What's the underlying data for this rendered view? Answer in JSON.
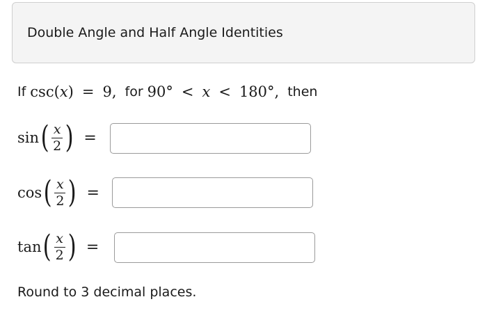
{
  "header": {
    "title": "Double Angle and Half Angle Identities"
  },
  "question": {
    "if_label": "If",
    "csc_fn": "csc",
    "open_paren": "(",
    "var": "x",
    "close_paren": ")",
    "equals": "=",
    "value": "9,",
    "for_label": "for",
    "lower_bound": "90°",
    "lt1": "<",
    "var2": "x",
    "lt2": "<",
    "upper_bound": "180°,",
    "then_label": "then"
  },
  "rows": [
    {
      "fn": "sin",
      "numerator": "x",
      "denominator": "2",
      "equals": "=",
      "input_value": ""
    },
    {
      "fn": "cos",
      "numerator": "x",
      "denominator": "2",
      "equals": "=",
      "input_value": ""
    },
    {
      "fn": "tan",
      "numerator": "x",
      "denominator": "2",
      "equals": "=",
      "input_value": ""
    }
  ],
  "footer": {
    "note": "Round to 3 decimal places."
  }
}
